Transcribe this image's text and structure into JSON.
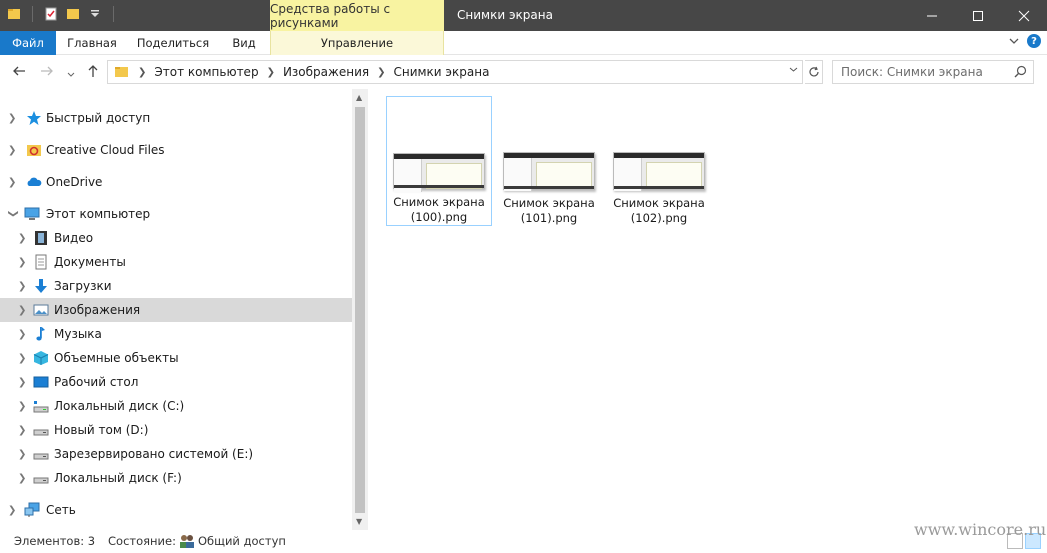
{
  "titlebar": {
    "tools_tab": "Средства работы с рисунками",
    "title": "Снимки экрана"
  },
  "ribbon": {
    "file": "Файл",
    "home": "Главная",
    "share": "Поделиться",
    "view": "Вид",
    "manage": "Управление"
  },
  "address": {
    "crumbs": [
      "Этот компьютер",
      "Изображения",
      "Снимки экрана"
    ],
    "search_placeholder": "Поиск: Снимки экрана"
  },
  "sidebar": {
    "items": [
      {
        "label": "Быстрый доступ",
        "icon": "star-icon"
      },
      {
        "label": "Creative Cloud Files",
        "icon": "creative-cloud-icon"
      },
      {
        "label": "OneDrive",
        "icon": "cloud-icon"
      },
      {
        "label": "Этот компьютер",
        "icon": "computer-icon"
      },
      {
        "label": "Видео",
        "icon": "video-icon"
      },
      {
        "label": "Документы",
        "icon": "document-icon"
      },
      {
        "label": "Загрузки",
        "icon": "download-icon"
      },
      {
        "label": "Изображения",
        "icon": "pictures-icon"
      },
      {
        "label": "Музыка",
        "icon": "music-icon"
      },
      {
        "label": "Объемные объекты",
        "icon": "cube-icon"
      },
      {
        "label": "Рабочий стол",
        "icon": "desktop-icon"
      },
      {
        "label": "Локальный диск (C:)",
        "icon": "drive-icon"
      },
      {
        "label": "Новый том (D:)",
        "icon": "drive-icon"
      },
      {
        "label": "Зарезервировано системой (E:)",
        "icon": "drive-icon"
      },
      {
        "label": "Локальный диск (F:)",
        "icon": "drive-icon"
      },
      {
        "label": "Сеть",
        "icon": "network-icon"
      }
    ]
  },
  "files": [
    {
      "line1": "Снимок экрана",
      "line2": "(100).png"
    },
    {
      "line1": "Снимок экрана",
      "line2": "(101).png"
    },
    {
      "line1": "Снимок экрана",
      "line2": "(102).png"
    }
  ],
  "status": {
    "count": "Элементов: 3",
    "state_label": "Состояние:",
    "state_value": "Общий доступ"
  },
  "watermark": "www.wincore.ru"
}
